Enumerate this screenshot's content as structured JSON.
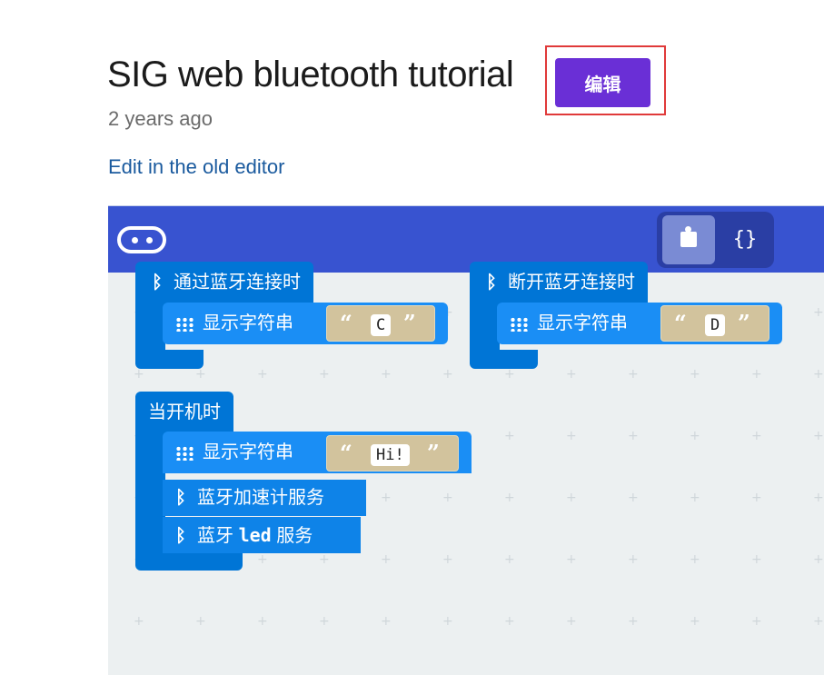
{
  "header": {
    "title": "SIG web bluetooth tutorial",
    "time_ago": "2 years ago",
    "old_editor_link": "Edit in the old editor",
    "edit_button": "编辑"
  },
  "editor": {
    "toolbar": {
      "logo_icon": "microbit-logo-icon",
      "blocks_toggle_icon": "puzzle-icon",
      "javascript_toggle": "{}"
    },
    "blocks": {
      "on_connected": {
        "label": "通过蓝牙连接时",
        "show_string_label": "显示字符串",
        "string_value": "C"
      },
      "on_disconnected": {
        "label": "断开蓝牙连接时",
        "show_string_label": "显示字符串",
        "string_value": "D"
      },
      "on_start": {
        "label": "当开机时",
        "show_string_label": "显示字符串",
        "string_value": "Hi!",
        "accel_service_label": "蓝牙加速计服务",
        "led_service_prefix": "蓝牙",
        "led_service_word": "led",
        "led_service_suffix": "服务"
      },
      "open_quote": "“",
      "close_quote": "”"
    },
    "colors": {
      "topbar": "#3853d0",
      "event_block": "#0075d6",
      "statement_block": "#1a8ef5",
      "string_block": "#d2c39d",
      "edit_button": "#6a2fd6",
      "highlight": "#e03a3a"
    }
  }
}
